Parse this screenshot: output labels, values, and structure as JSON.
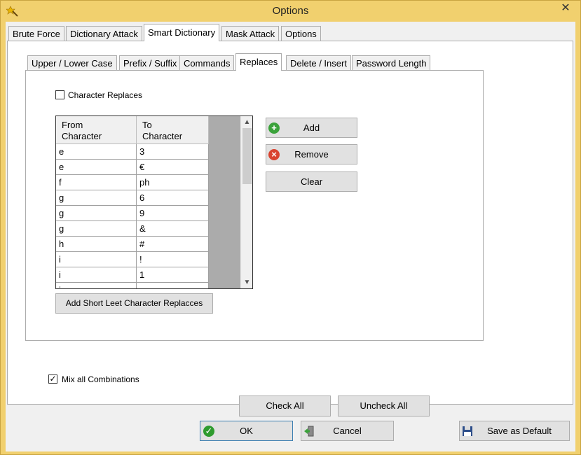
{
  "window": {
    "title": "Options",
    "close_glyph": "✕",
    "icon": "wand-icon"
  },
  "main_tabs": [
    {
      "label": "Brute Force"
    },
    {
      "label": "Dictionary Attack"
    },
    {
      "label": "Smart Dictionary",
      "active": true
    },
    {
      "label": "Mask Attack"
    },
    {
      "label": "Options"
    }
  ],
  "sub_tabs": [
    {
      "label": "Upper / Lower Case"
    },
    {
      "label": "Prefix / Suffix"
    },
    {
      "label": "Commands"
    },
    {
      "label": "Replaces",
      "active": true
    },
    {
      "label": "Delete / Insert"
    },
    {
      "label": "Password Length"
    }
  ],
  "replaces": {
    "character_replaces_label": "Character Replaces",
    "character_replaces_checked": false,
    "columns": [
      "From\nCharacter",
      "To\nCharacter"
    ],
    "rows": [
      [
        "e",
        "3"
      ],
      [
        "e",
        "€"
      ],
      [
        "f",
        "ph"
      ],
      [
        "g",
        "6"
      ],
      [
        "g",
        "9"
      ],
      [
        "g",
        "&"
      ],
      [
        "h",
        "#"
      ],
      [
        "i",
        "!"
      ],
      [
        "i",
        "1"
      ],
      [
        "i",
        "¡"
      ]
    ],
    "add_label": "Add",
    "remove_label": "Remove",
    "clear_label": "Clear",
    "add_leet_label": "Add Short Leet Character Replacces"
  },
  "mix_all_label": "Mix all Combinations",
  "mix_all_checked": true,
  "check_all_label": "Check All",
  "uncheck_all_label": "Uncheck All",
  "footer": {
    "ok_label": "OK",
    "cancel_label": "Cancel",
    "save_default_label": "Save as Default"
  },
  "colors": {
    "title_bar": "#f1d06e",
    "add_icon": "#3aa23a",
    "remove_icon": "#d9432f",
    "ok_icon": "#2e9b2e"
  }
}
